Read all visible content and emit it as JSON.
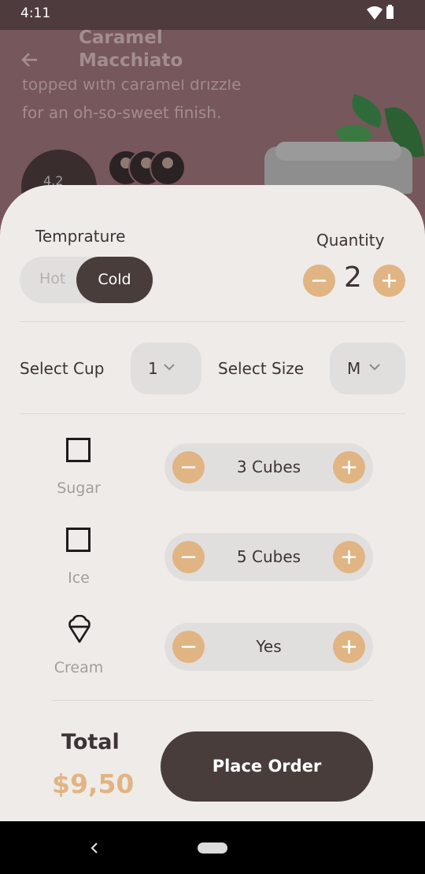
{
  "status_bar": {
    "time": "4:11"
  },
  "product": {
    "title": "Caramel Macchiato",
    "description_line_1": "topped with caramel drizzle",
    "description_line_2": "for an oh-so-sweet finish.",
    "rating": "4.2"
  },
  "temperature": {
    "label": "Temprature",
    "options": [
      "Hot",
      "Cold"
    ],
    "selected": "Cold"
  },
  "quantity": {
    "label": "Quantity",
    "value": "2"
  },
  "cup": {
    "label": "Select Cup",
    "value": "1"
  },
  "size": {
    "label": "Select Size",
    "value": "M"
  },
  "addons": [
    {
      "name": "Sugar",
      "value": "3 Cubes",
      "icon": "checkbox-icon"
    },
    {
      "name": "Ice",
      "value": "5 Cubes",
      "icon": "checkbox-icon"
    },
    {
      "name": "Cream",
      "value": "Yes",
      "icon": "ice-cream-icon"
    }
  ],
  "total": {
    "label": "Total",
    "price": "$9,50"
  },
  "actions": {
    "place_order": "Place Order"
  },
  "colors": {
    "accent": "#e0b583",
    "dark": "#483d3b",
    "sheet": "#efebe8",
    "pill": "#e1dfde"
  }
}
